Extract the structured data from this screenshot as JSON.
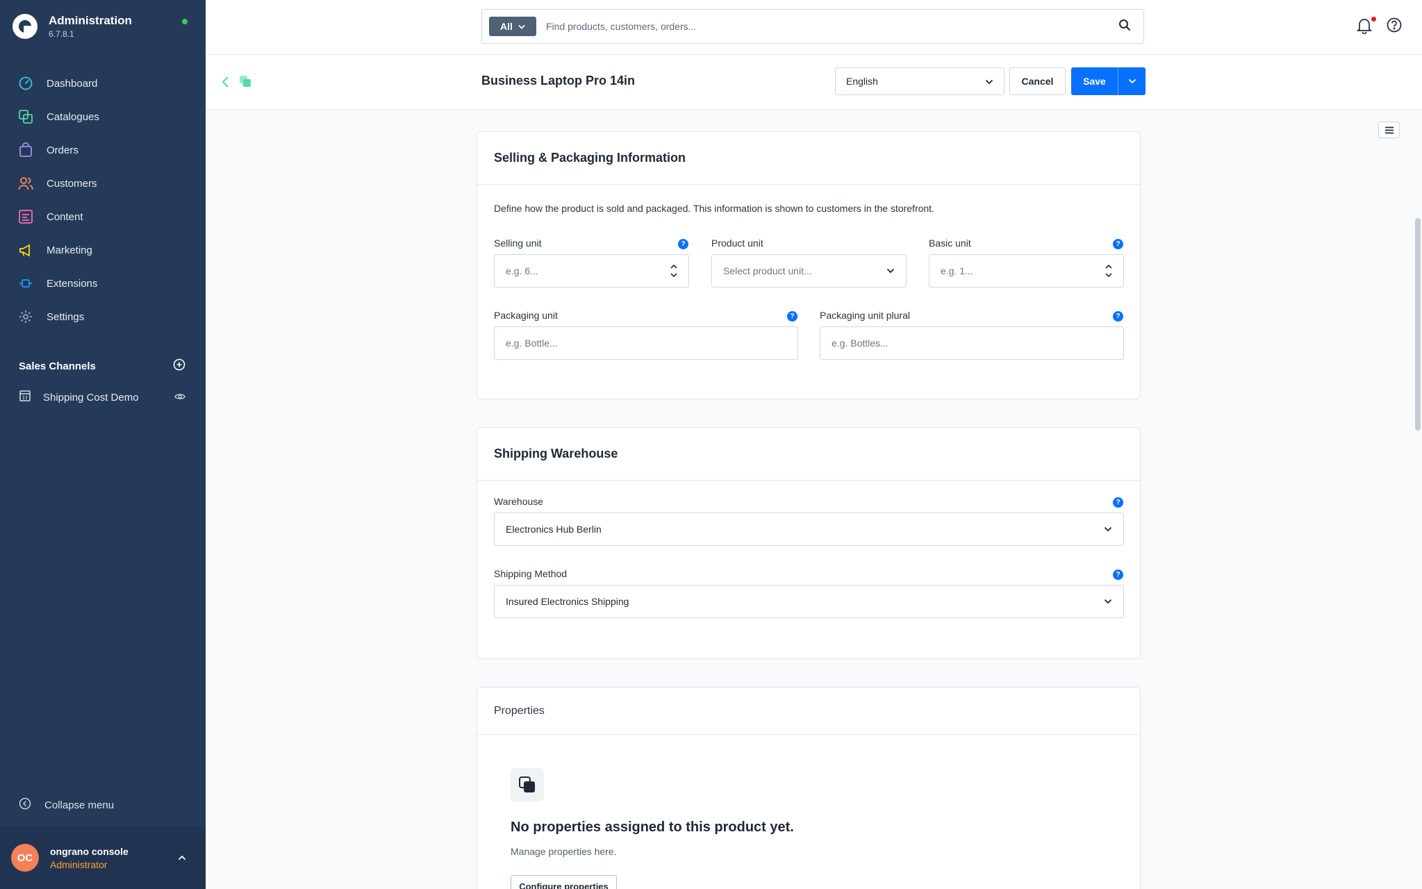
{
  "app": {
    "title": "Administration",
    "version": "6.7.8.1"
  },
  "nav": {
    "items": [
      {
        "label": "Dashboard",
        "icon": "dashboard-icon",
        "color": "#3fc1e6"
      },
      {
        "label": "Catalogues",
        "icon": "catalogue-icon",
        "color": "#57d9a3"
      },
      {
        "label": "Orders",
        "icon": "orders-icon",
        "color": "#a092f0"
      },
      {
        "label": "Customers",
        "icon": "customers-icon",
        "color": "#f88962"
      },
      {
        "label": "Content",
        "icon": "content-icon",
        "color": "#ff68b4"
      },
      {
        "label": "Marketing",
        "icon": "marketing-icon",
        "color": "#ffd700"
      },
      {
        "label": "Extensions",
        "icon": "extensions-icon",
        "color": "#189eff"
      },
      {
        "label": "Settings",
        "icon": "settings-icon",
        "color": "#9aa8b5"
      }
    ]
  },
  "sales_channels": {
    "title": "Sales Channels",
    "items": [
      {
        "label": "Shipping Cost Demo"
      }
    ]
  },
  "collapse_label": "Collapse menu",
  "user": {
    "initials": "OC",
    "name": "ongrano console",
    "role": "Administrator"
  },
  "search": {
    "scope": "All",
    "placeholder": "Find products, customers, orders..."
  },
  "smartbar": {
    "title": "Business Laptop Pro 14in",
    "language": "English",
    "cancel_label": "Cancel",
    "save_label": "Save"
  },
  "selling_card": {
    "title": "Selling & Packaging Information",
    "description": "Define how the product is sold and packaged. This information is shown to customers in the storefront.",
    "selling_unit": {
      "label": "Selling unit",
      "placeholder": "e.g. 6..."
    },
    "product_unit": {
      "label": "Product unit",
      "placeholder": "Select product unit..."
    },
    "basic_unit": {
      "label": "Basic unit",
      "placeholder": "e.g. 1..."
    },
    "packaging_unit": {
      "label": "Packaging unit",
      "placeholder": "e.g. Bottle..."
    },
    "packaging_unit_plural": {
      "label": "Packaging unit plural",
      "placeholder": "e.g. Bottles..."
    }
  },
  "warehouse_card": {
    "title": "Shipping Warehouse",
    "warehouse": {
      "label": "Warehouse",
      "value": "Electronics Hub Berlin"
    },
    "shipping_method": {
      "label": "Shipping Method",
      "value": "Insured Electronics Shipping"
    }
  },
  "properties_card": {
    "title": "Properties",
    "empty_title": "No properties assigned to this product yet.",
    "empty_subtitle": "Manage properties here.",
    "configure_label": "Configure properties"
  },
  "colors": {
    "sidebar": "#253a58",
    "primary": "#0870ff",
    "online": "#37d046",
    "user_role": "#ffa03a"
  }
}
